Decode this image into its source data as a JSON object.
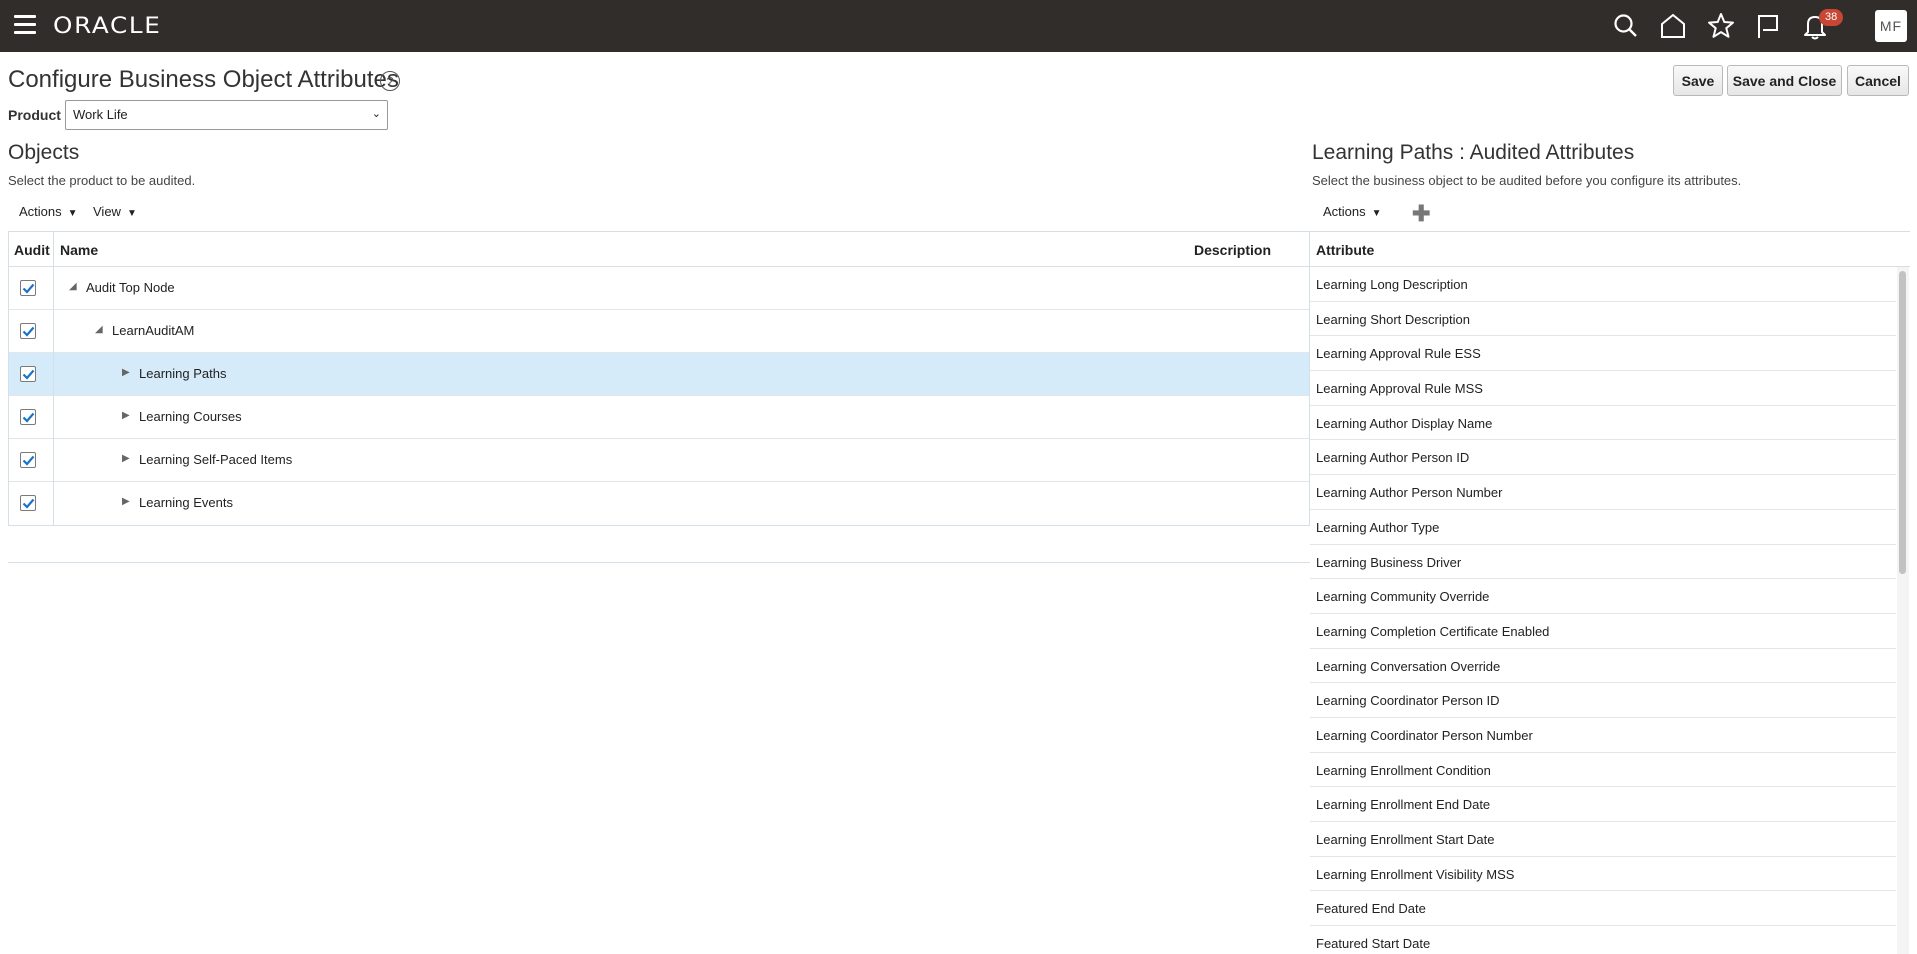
{
  "topbar": {
    "logo": "ORACLE",
    "notification_count": "38",
    "avatar_initials": "MF",
    "icons": [
      "menu-icon",
      "search-icon",
      "home-icon",
      "star-icon",
      "flag-icon",
      "bell-icon"
    ]
  },
  "header": {
    "title": "Configure Business Object Attributes",
    "help": "?",
    "save_label": "Save",
    "save_close_label": "Save and Close",
    "cancel_label": "Cancel",
    "product_label": "Product",
    "product_value": "Work Life"
  },
  "objects": {
    "title": "Objects",
    "description": "Select the product to be audited.",
    "actions_label": "Actions",
    "view_label": "View",
    "columns": {
      "audit": "Audit",
      "name": "Name",
      "description": "Description"
    },
    "rows": [
      {
        "name": "Audit Top Node",
        "checked": true,
        "expanded": true,
        "level": 0
      },
      {
        "name": "LearnAuditAM",
        "checked": true,
        "expanded": true,
        "level": 1
      },
      {
        "name": "Learning Paths",
        "checked": true,
        "expanded": false,
        "level": 2,
        "selected": true
      },
      {
        "name": "Learning Courses",
        "checked": true,
        "expanded": false,
        "level": 2
      },
      {
        "name": "Learning Self-Paced Items",
        "checked": true,
        "expanded": false,
        "level": 2
      },
      {
        "name": "Learning Events",
        "checked": true,
        "expanded": false,
        "level": 2
      }
    ]
  },
  "attributes": {
    "title": "Learning Paths : Audited Attributes",
    "description": "Select the business object to be audited before you configure its attributes.",
    "actions_label": "Actions",
    "column": "Attribute",
    "rows": [
      "Learning Long Description",
      "Learning Short Description",
      "Learning Approval Rule ESS",
      "Learning Approval Rule MSS",
      "Learning Author Display Name",
      "Learning Author Person ID",
      "Learning Author Person Number",
      "Learning Author Type",
      "Learning Business Driver",
      "Learning Community Override",
      "Learning Completion Certificate Enabled",
      "Learning Conversation Override",
      "Learning Coordinator Person ID",
      "Learning Coordinator Person Number",
      "Learning Enrollment Condition",
      "Learning Enrollment End Date",
      "Learning Enrollment Start Date",
      "Learning Enrollment Visibility MSS",
      "Featured End Date",
      "Featured Start Date"
    ]
  },
  "colors": {
    "topbar": "#312d2a",
    "selected_row": "#d6ebfa",
    "checkbox": "#1a73c6",
    "badge": "#c74634"
  }
}
